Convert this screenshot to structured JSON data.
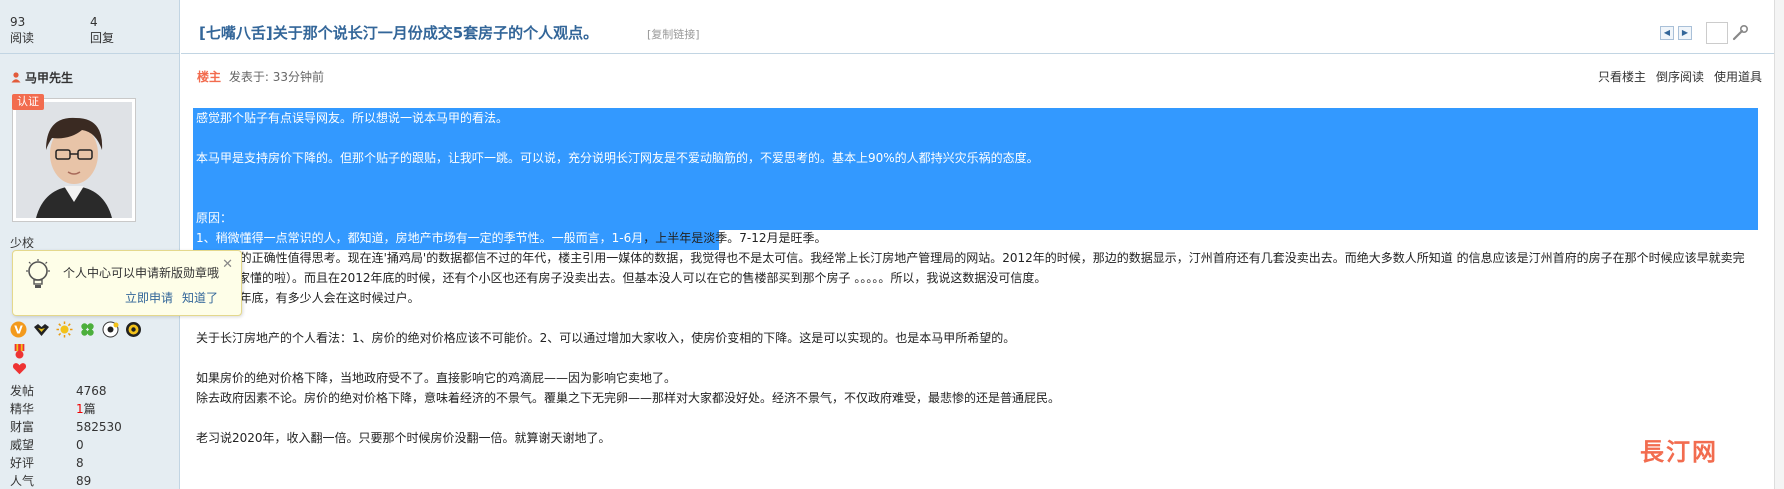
{
  "stats": {
    "views_count": "93",
    "views_label": "阅读",
    "replies_count": "4",
    "replies_label": "回复"
  },
  "thread": {
    "title": "[七嘴八舌]关于那个说长汀一月份成交5套房子的个人观点。",
    "copy_link": "[复制链接]",
    "prev_icon": "chevron-left-icon",
    "next_icon": "chevron-right-icon"
  },
  "author": {
    "name": "马甲先生",
    "badge": "认证",
    "rank": "少校",
    "stats": [
      {
        "k": "发帖",
        "v": "4768"
      },
      {
        "k": "精华",
        "v": "1",
        "suffix": "篇"
      },
      {
        "k": "财富",
        "v": "582530"
      },
      {
        "k": "威望",
        "v": "0"
      },
      {
        "k": "好评",
        "v": "8"
      },
      {
        "k": "人气",
        "v": "89"
      }
    ]
  },
  "tip": {
    "text": "个人中心可以申请新版勋章哦",
    "close": "✕",
    "apply": "立即申请",
    "know": "知道了"
  },
  "post": {
    "floor": "楼主",
    "posted": "发表于: 33分钟前",
    "actions": [
      "只看楼主",
      "倒序阅读",
      "使用道具"
    ],
    "lines": [
      "感觉那个贴子有点误导网友。所以想说一说本马甲的看法。",
      "",
      "本马甲是支持房价下降的。但那个贴子的跟贴，让我吓一跳。可以说，充分说明长汀网友是不爱动脑筋的，不爱思考的。基本上90%的人都持兴灾乐祸的态度。",
      "",
      "",
      "原因：",
      "1、稍微懂得一点常识的人，都知道，房地产市场有一定的季节性。一般而言，1-6月，上半年是淡季。7-12月是旺季。",
      "2、数据的正确性值得思考。现在连'捅鸡局'的数据都信不过的年代，楼主引用一媒体的数据，我觉得也不是太可信。我经常上长汀房地产管理局的网站。2012年的时候，那边的数据显示，汀州首府还有几套没卖出去。而绝大多数人所知道 的信息应该是汀州首府的房子在那个时候应该早就卖完了。（大家懂的啦）。而且在2012年底的时候，还有个小区也还有房子没卖出去。但基本没人可以在它的售楼部买到那个房子 。。。。。所以，我说这数据没可信度。",
      "3、因为年底，有多少人会在这时候过户。",
      "",
      "关于长汀房地产的个人看法：1、房价的绝对价格应该不可能价。2、可以通过增加大家收入，使房价变相的下降。这是可以实现的。也是本马甲所希望的。",
      "",
      "如果房价的绝对价格下降，当地政府受不了。直接影响它的鸡滴屁——因为影响它卖地了。",
      "除去政府因素不论。房价的绝对价格下降，意味着经济的不景气。覆巢之下无完卵——那样对大家都没好处。经济不景气，不仅政府难受，最悲惨的还是普通屁民。",
      "",
      "老习说2020年，收入翻一倍。只要那个时候房价没翻一倍。就算谢天谢地了。"
    ]
  },
  "watermark": "長汀网",
  "colors": {
    "selection": "#3399ff",
    "title": "#336699",
    "floor": "#f26c4f",
    "sidebar_bg": "#e5edf2"
  }
}
